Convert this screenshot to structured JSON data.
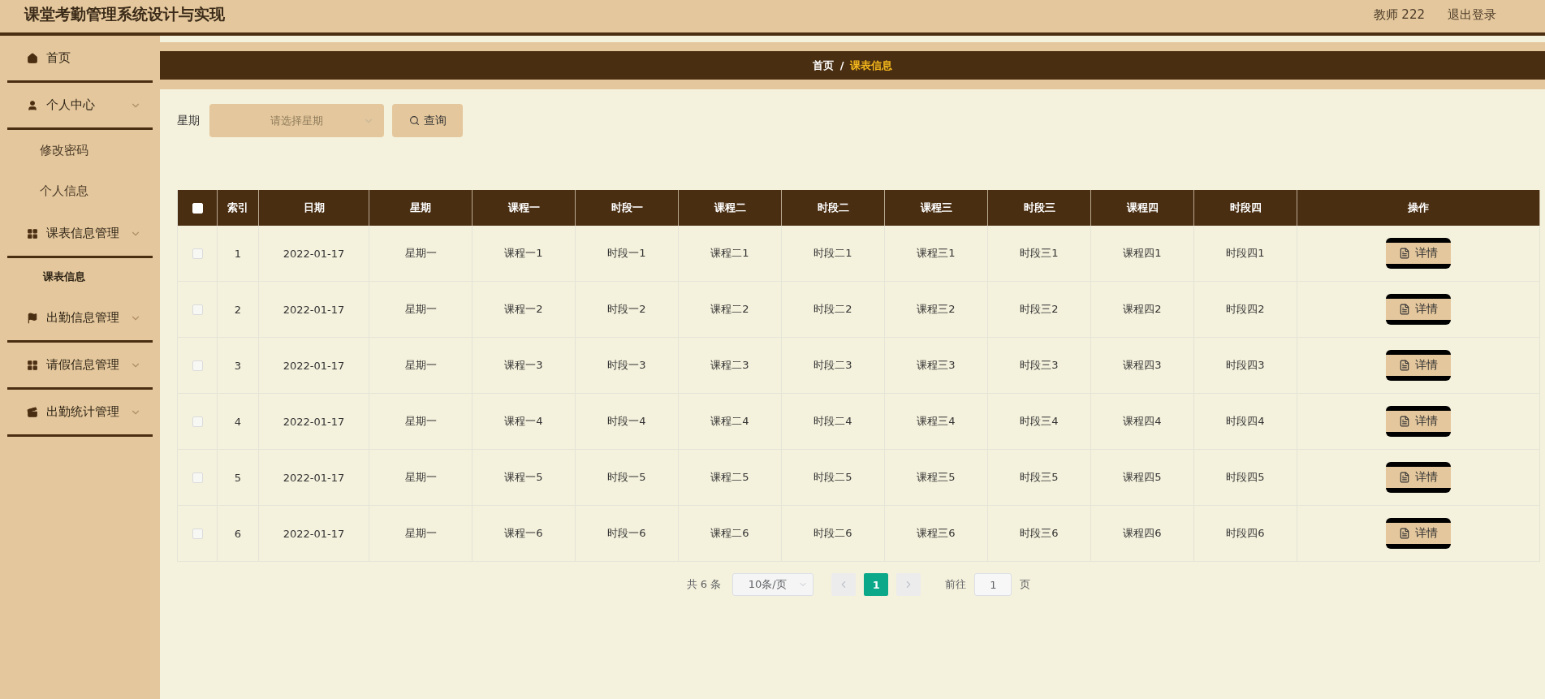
{
  "header": {
    "title": "课堂考勤管理系统设计与实现",
    "user": "教师 222",
    "logout": "退出登录"
  },
  "sidebar": {
    "items": [
      {
        "label": "首页",
        "kind": "link",
        "selected": false
      },
      {
        "label": "个人中心",
        "kind": "submenu",
        "selected": false,
        "children": [
          {
            "label": "修改密码",
            "selected": false
          },
          {
            "label": "个人信息",
            "selected": false
          }
        ]
      },
      {
        "label": "课表信息管理",
        "kind": "submenu",
        "selected": false,
        "children": [
          {
            "label": "课表信息",
            "selected": true
          }
        ]
      },
      {
        "label": "出勤信息管理",
        "kind": "submenu",
        "selected": false
      },
      {
        "label": "请假信息管理",
        "kind": "submenu",
        "selected": false
      },
      {
        "label": "出勤统计管理",
        "kind": "submenu",
        "selected": false
      }
    ]
  },
  "breadcrumb": {
    "home": "首页",
    "separator": "/",
    "current": "课表信息"
  },
  "search": {
    "label": "星期",
    "placeholder": "请选择星期",
    "button": "查询"
  },
  "table": {
    "select_all_checked": false,
    "columns": [
      "索引",
      "日期",
      "星期",
      "课程一",
      "时段一",
      "课程二",
      "时段二",
      "课程三",
      "时段三",
      "课程四",
      "时段四",
      "操作"
    ],
    "rows": [
      {
        "checked": false,
        "cells": [
          "1",
          "2022-01-17",
          "星期一",
          "课程一1",
          "时段一1",
          "课程二1",
          "时段二1",
          "课程三1",
          "时段三1",
          "课程四1",
          "时段四1"
        ],
        "action": "详情"
      },
      {
        "checked": false,
        "cells": [
          "2",
          "2022-01-17",
          "星期一",
          "课程一2",
          "时段一2",
          "课程二2",
          "时段二2",
          "课程三2",
          "时段三2",
          "课程四2",
          "时段四2"
        ],
        "action": "详情"
      },
      {
        "checked": false,
        "cells": [
          "3",
          "2022-01-17",
          "星期一",
          "课程一3",
          "时段一3",
          "课程二3",
          "时段二3",
          "课程三3",
          "时段三3",
          "课程四3",
          "时段四3"
        ],
        "action": "详情"
      },
      {
        "checked": false,
        "cells": [
          "4",
          "2022-01-17",
          "星期一",
          "课程一4",
          "时段一4",
          "课程二4",
          "时段二4",
          "课程三4",
          "时段三4",
          "课程四4",
          "时段四4"
        ],
        "action": "详情"
      },
      {
        "checked": false,
        "cells": [
          "5",
          "2022-01-17",
          "星期一",
          "课程一5",
          "时段一5",
          "课程二5",
          "时段二5",
          "课程三5",
          "时段三5",
          "课程四5",
          "时段四5"
        ],
        "action": "详情"
      },
      {
        "checked": false,
        "cells": [
          "6",
          "2022-01-17",
          "星期一",
          "课程一6",
          "时段一6",
          "课程二6",
          "时段二6",
          "课程三6",
          "时段三6",
          "课程四6",
          "时段四6"
        ],
        "action": "详情"
      }
    ]
  },
  "pagination": {
    "total": "共 6 条",
    "page_size": "10条/页",
    "pages": [
      {
        "label": "1",
        "selected": true
      }
    ],
    "goto_label": "前往",
    "goto_value": "1",
    "goto_suffix": "页"
  }
}
